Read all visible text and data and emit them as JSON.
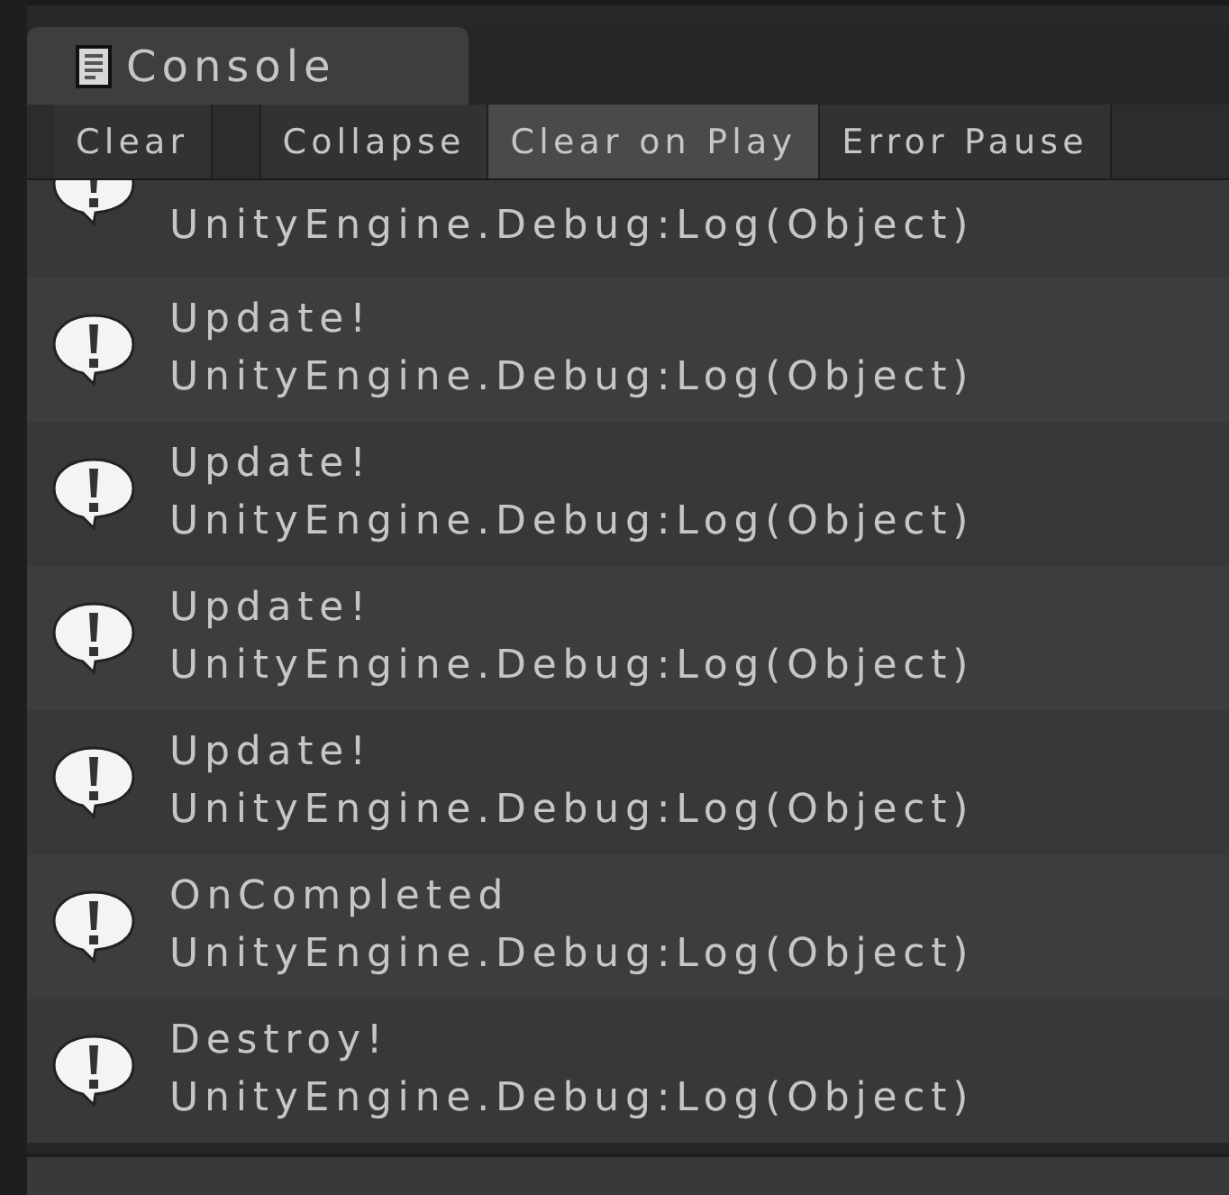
{
  "tab": {
    "title": "Console"
  },
  "toolbar": [
    {
      "label": "Clear",
      "selected": false
    },
    {
      "label": "Collapse",
      "selected": false
    },
    {
      "label": "Clear on Play",
      "selected": true
    },
    {
      "label": "Error Pause",
      "selected": false
    }
  ],
  "entries": [
    {
      "stack": "UnityEngine.Debug:Log(Object)"
    },
    {
      "message": "Update!",
      "stack": "UnityEngine.Debug:Log(Object)"
    },
    {
      "message": "Update!",
      "stack": "UnityEngine.Debug:Log(Object)"
    },
    {
      "message": "Update!",
      "stack": "UnityEngine.Debug:Log(Object)"
    },
    {
      "message": "Update!",
      "stack": "UnityEngine.Debug:Log(Object)"
    },
    {
      "message": "OnCompleted",
      "stack": "UnityEngine.Debug:Log(Object)"
    },
    {
      "message": "Destroy!",
      "stack": "UnityEngine.Debug:Log(Object)"
    }
  ]
}
